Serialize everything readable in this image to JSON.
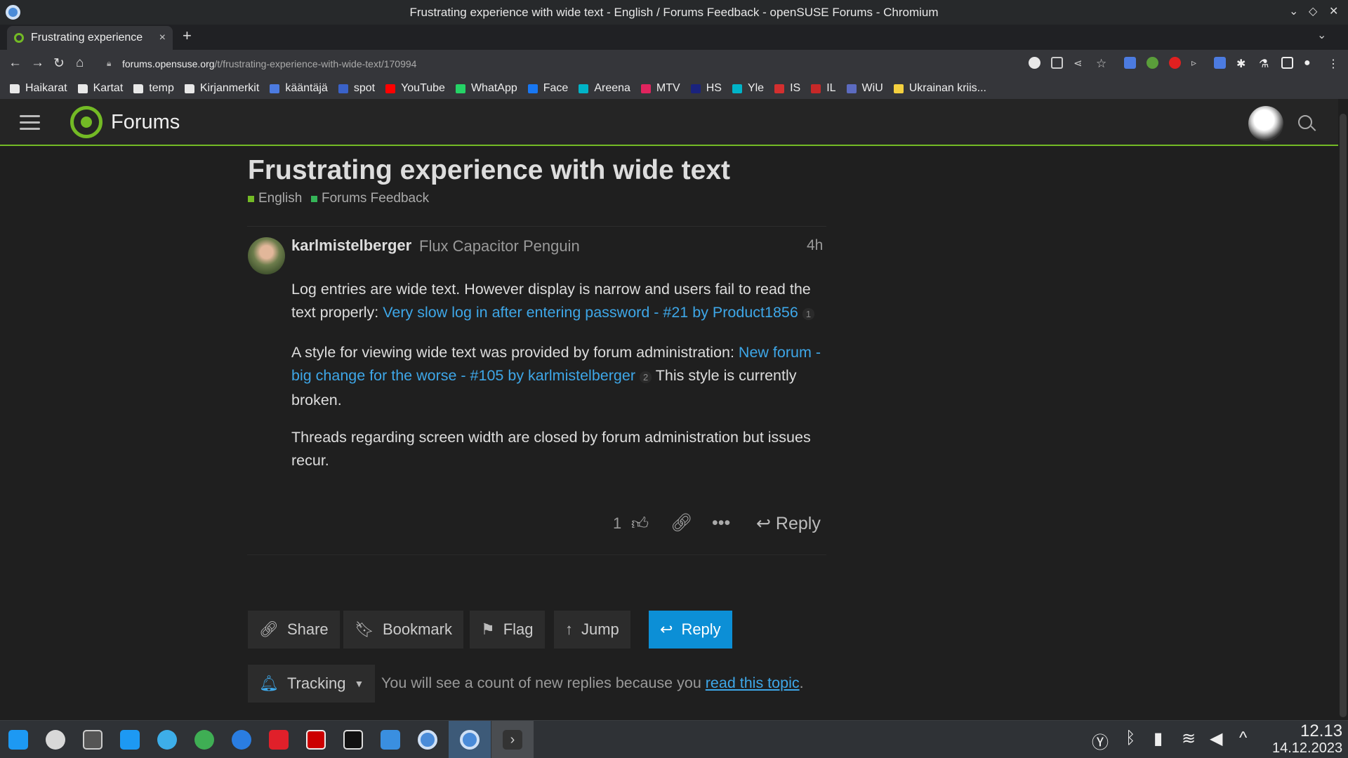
{
  "window": {
    "title": "Frustrating experience with wide text - English / Forums Feedback - openSUSE Forums - Chromium"
  },
  "tab": {
    "title": "Frustrating experience",
    "close": "×",
    "new": "+"
  },
  "toolbar": {
    "url_host": "forums.opensuse.org",
    "url_path": "/t/frustrating-experience-with-wide-text/170994"
  },
  "bookmarks": [
    {
      "label": "Haikarat",
      "icon": "folder"
    },
    {
      "label": "Kartat",
      "icon": "folder"
    },
    {
      "label": "temp",
      "icon": "folder"
    },
    {
      "label": "Kirjanmerkit",
      "icon": "folder"
    },
    {
      "label": "kääntäjä",
      "icon": "#4c7be0"
    },
    {
      "label": "spot",
      "icon": "#3a62c9"
    },
    {
      "label": "YouTube",
      "icon": "#ff0000"
    },
    {
      "label": "WhatApp",
      "icon": "#25d366"
    },
    {
      "label": "Face",
      "icon": "#1877f2"
    },
    {
      "label": "Areena",
      "icon": "#00b4c8"
    },
    {
      "label": "MTV",
      "icon": "#e0245e"
    },
    {
      "label": "HS",
      "icon": "#1a237e"
    },
    {
      "label": "Yle",
      "icon": "#00b4c8"
    },
    {
      "label": "IS",
      "icon": "#d32f2f"
    },
    {
      "label": "IL",
      "icon": "#c62828"
    },
    {
      "label": "WiU",
      "icon": "#5c6bc0"
    },
    {
      "label": "Ukrainan kriis...",
      "icon": "#f4d03f"
    }
  ],
  "forum": {
    "name": "Forums"
  },
  "topic": {
    "title": "Frustrating experience with wide text",
    "categories": [
      {
        "name": "English",
        "color": "#73ba25"
      },
      {
        "name": "Forums Feedback",
        "color": "#35b558"
      }
    ]
  },
  "post": {
    "username": "karlmistelberger",
    "user_title": "Flux Capacitor Penguin",
    "time": "4h",
    "p1_text": "Log entries are wide text. However display is narrow and users fail to read the text properly: ",
    "p1_link": "Very slow log in after entering password - #21 by Product1856",
    "p1_count": "1",
    "p2_text": "A style for viewing wide text was provided by forum administration: ",
    "p2_link": "New forum - big change for the worse - #105 by karlmistelberger",
    "p2_count": "2",
    "p2_tail": " This style is currently broken.",
    "p3_text": "Threads regarding screen width are closed by forum administration but issues recur.",
    "likes": "1",
    "reply_label": "Reply"
  },
  "footer": {
    "share": "Share",
    "bookmark": "Bookmark",
    "flag": "Flag",
    "jump": "Jump",
    "reply": "Reply",
    "tracking": "Tracking",
    "tracking_msg": "You will see a count of new replies because you ",
    "tracking_link": "read this topic",
    "tracking_end": "."
  },
  "taskbar": {
    "time": "12.13",
    "date": "14.12.2023"
  },
  "colors": {
    "accent": "#73ba25",
    "link": "#3ea7e8",
    "reply_button": "#0c8fd6"
  }
}
